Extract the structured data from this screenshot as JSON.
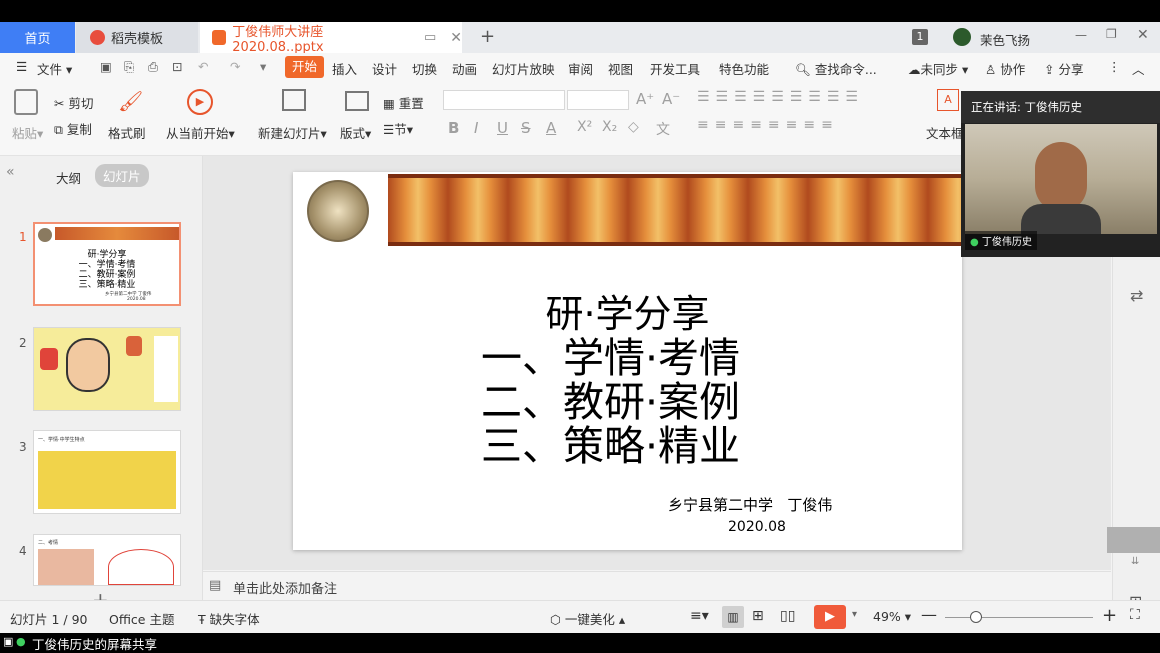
{
  "tabs": {
    "home": "首页",
    "template": "稻壳模板",
    "document": "丁俊伟师大讲座2020.08..pptx",
    "page_count_badge": "1",
    "user": "茉色飞扬"
  },
  "menu": {
    "file": "文件",
    "items": [
      "开始",
      "插入",
      "设计",
      "切换",
      "动画",
      "幻灯片放映",
      "审阅",
      "视图",
      "开发工具",
      "特色功能"
    ],
    "search": "查找命令...",
    "sync": "未同步",
    "collab": "协作",
    "share": "分享"
  },
  "ribbon": {
    "paste": "粘贴",
    "cut": "剪切",
    "copy": "复制",
    "format_painter": "格式刷",
    "play_from_current": "从当前开始",
    "new_slide": "新建幻灯片",
    "layout": "版式",
    "reset": "重置",
    "section": "节",
    "textbox": "文本框"
  },
  "leftpane": {
    "outline_tab": "大纲",
    "slides_tab": "幻灯片",
    "thumb_numbers": [
      "1",
      "2",
      "3",
      "4"
    ],
    "thumb1_lines": [
      "研·学分享",
      "一、学情·考情",
      "二、教研·案例",
      "三、策略·精业"
    ],
    "thumb1_footer": "乡宁县第二中学 丁俊伟",
    "thumb1_date": "2020.08",
    "thumb3_title": "一、学情·中学生特点",
    "thumb4_title": "二、考情"
  },
  "slide": {
    "title": "研·学分享",
    "lines": [
      "一、学情·考情",
      "二、教研·案例",
      "三、策略·精业"
    ],
    "school": "乡宁县第二中学",
    "author": "丁俊伟",
    "date": "2020.08"
  },
  "notes_placeholder": "单击此处添加备注",
  "status": {
    "slide_info": "幻灯片 1 / 90",
    "theme": "Office 主题",
    "missing_font": "缺失字体",
    "beautify": "一键美化",
    "zoom": "49%"
  },
  "video": {
    "speaking": "正在讲话: 丁俊伟历史",
    "name": "丁俊伟历史"
  },
  "share_bar": "丁俊伟历史的屏幕共享",
  "colors": {
    "accent_blue": "#3f7ef5",
    "start_orange": "#f0682a",
    "play_red": "#f05a3a",
    "banner": "#c7592a"
  }
}
